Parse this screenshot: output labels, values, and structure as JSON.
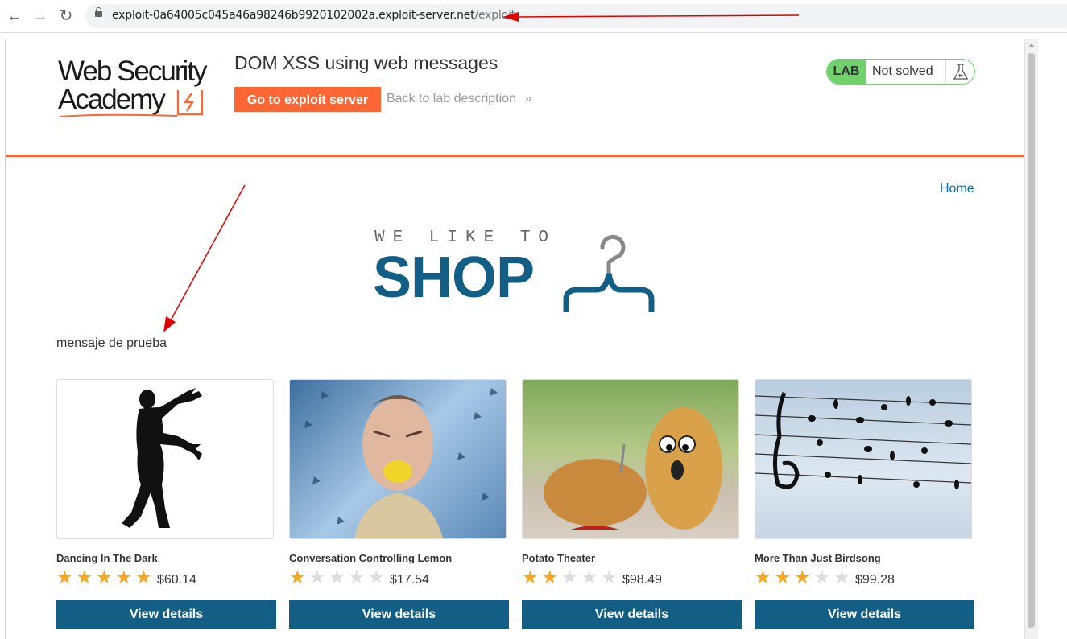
{
  "browser": {
    "url_host": "exploit-0a64005c045a46a98246b9920102002a.exploit-server.net",
    "url_path": "/exploit"
  },
  "lab_header": {
    "logo_line1": "Web Security",
    "logo_line2": "Academy",
    "title": "DOM XSS using web messages",
    "exploit_button": "Go to exploit server",
    "back_link": "Back to lab description",
    "back_chevron": "»",
    "status_badge": "LAB",
    "status_text": "Not solved",
    "colors": {
      "accent": "#ff6633",
      "status_green": "#70d16d"
    }
  },
  "shop": {
    "home_link": "Home",
    "tagline": "WE LIKE TO",
    "title": "SHOP",
    "message": "mensaje de prueba",
    "brand_color": "#135e84",
    "products": [
      {
        "name": "Dancing In The Dark",
        "price": "$60.14",
        "rating": 5,
        "button": "View details",
        "image": "dancing-silhouette"
      },
      {
        "name": "Conversation Controlling Lemon",
        "price": "$17.54",
        "rating": 1,
        "button": "View details",
        "image": "man-lemon"
      },
      {
        "name": "Potato Theater",
        "price": "$98.49",
        "rating": 2,
        "button": "View details",
        "image": "potatoes"
      },
      {
        "name": "More Than Just Birdsong",
        "price": "$99.28",
        "rating": 3,
        "button": "View details",
        "image": "birds-music-notes"
      }
    ]
  }
}
